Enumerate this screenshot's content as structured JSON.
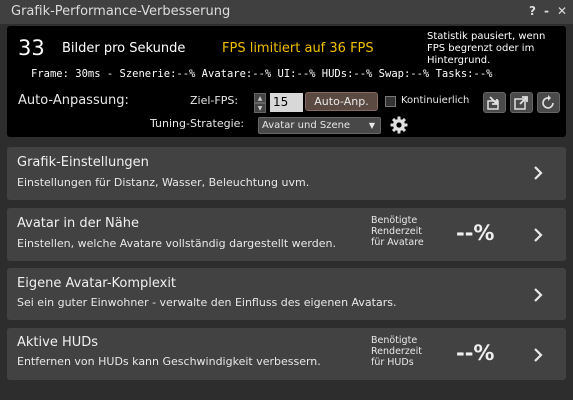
{
  "window": {
    "title": "Grafik-Performance-Verbesserung",
    "help_label": "?",
    "minimize_label": "-",
    "close_label": "✕"
  },
  "stats": {
    "fps_value": "33",
    "fps_label": "Bilder pro Sekunde",
    "fps_limit": "FPS limitiert auf 36 FPS",
    "paused_note": "Statistik pausiert, wenn FPS begrenzt oder im Hintergrund.",
    "frame_breakdown": "Frame: 30ms - Szenerie:--% Avatare:--% UI:--% HUDs:--% Swap:--% Tasks:--%"
  },
  "auto_tune": {
    "label": "Auto-Anpassung:",
    "target_fps_label": "Ziel-FPS:",
    "target_fps_value": "15",
    "auto_button_label": "Auto-Anp.",
    "continuous_label": "Kontinuierlich",
    "continuous_checked": false,
    "strategy_label": "Tuning-Strategie:",
    "strategy_value": "Avatar und Szene"
  },
  "panels": {
    "graphics": {
      "title": "Grafik-Einstellungen",
      "description": "Einstellungen für Distanz, Wasser, Beleuchtung uvm."
    },
    "nearby": {
      "title": "Avatar in der Nähe",
      "description": "Einstellen, welche Avatare vollständig dargestellt werden.",
      "render_label_1": "Benötigte",
      "render_label_2": "Renderzeit",
      "render_label_3": "für Avatare",
      "render_value": "--%"
    },
    "self": {
      "title": "Eigene Avatar-Komplexit",
      "description": "Sei ein guter Einwohner - verwalte den Einfluss des eigenen Avatars."
    },
    "huds": {
      "title": "Aktive HUDs",
      "description": "Entfernen von HUDs kann Geschwindigkeit verbessern.",
      "render_label_1": "Benötigte",
      "render_label_2": "Renderzeit",
      "render_label_3": "für HUDs",
      "render_value": "--%"
    }
  },
  "colors": {
    "window_bg": "#2d2d2d",
    "stats_bg": "#000000",
    "panel_bg": "#424242",
    "fps_limit": "#f0c000",
    "auto_button": "#5a4a42"
  },
  "icons": [
    "help-icon",
    "minimize-icon",
    "close-icon",
    "spinner-up-icon",
    "spinner-down-icon",
    "export-icon",
    "popout-icon",
    "refresh-icon",
    "gear-icon",
    "chevron-right-icon"
  ]
}
